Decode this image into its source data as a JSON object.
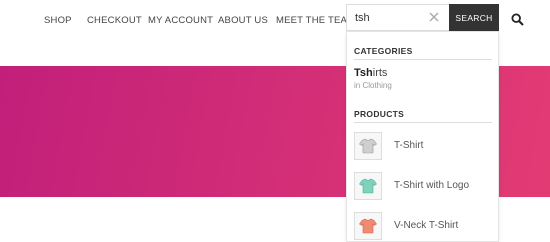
{
  "nav": {
    "items": [
      {
        "label": "SHOP"
      },
      {
        "label": "CHECKOUT"
      },
      {
        "label": "MY ACCOUNT"
      },
      {
        "label": "ABOUT US"
      },
      {
        "label": "MEET THE TEAM"
      }
    ]
  },
  "search": {
    "value": "tsh",
    "button_label": "SEARCH",
    "clear_icon": "close-icon",
    "toggle_icon": "search-icon"
  },
  "dropdown": {
    "categories_title": "CATEGORIES",
    "category": {
      "match": "Tsh",
      "rest": "irts",
      "sub": "in Clothing"
    },
    "products_title": "PRODUCTS",
    "products": [
      {
        "name": "T-Shirt",
        "color": "#cfcfcf"
      },
      {
        "name": "T-Shirt with Logo",
        "color": "#7fd3b8"
      },
      {
        "name": "V-Neck T-Shirt",
        "color": "#f08a72"
      }
    ]
  },
  "colors": {
    "hero_start": "#c21f7a",
    "hero_end": "#e23b74",
    "button_bg": "#333333"
  }
}
